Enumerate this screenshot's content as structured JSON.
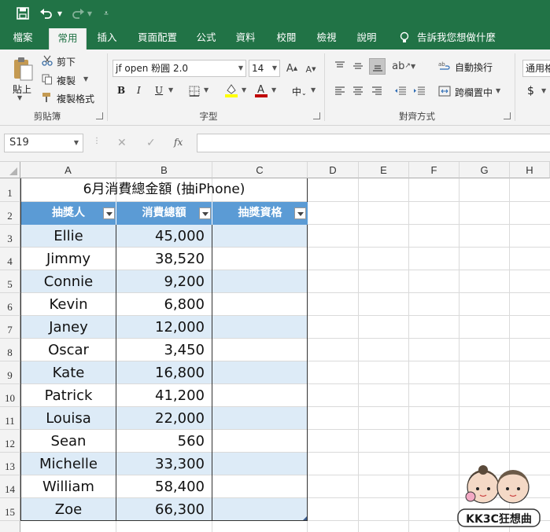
{
  "qat": {
    "save_icon": "save-icon",
    "undo_icon": "undo-icon",
    "redo_icon": "redo-icon",
    "customize_icon": "customize-qat-icon"
  },
  "tabs": [
    {
      "label": "檔案"
    },
    {
      "label": "常用"
    },
    {
      "label": "插入"
    },
    {
      "label": "頁面配置"
    },
    {
      "label": "公式"
    },
    {
      "label": "資料"
    },
    {
      "label": "校閱"
    },
    {
      "label": "檢視"
    },
    {
      "label": "說明"
    },
    {
      "label": "告訴我您想做什麼"
    }
  ],
  "active_tab": "常用",
  "clipboard": {
    "paste": "貼上",
    "cut": "剪下",
    "copy": "複製",
    "format_painter": "複製格式",
    "group": "剪貼簿"
  },
  "font": {
    "name": "jf open 粉圓 2.0",
    "size": "14",
    "bold": "B",
    "italic": "I",
    "underline": "U",
    "group": "字型",
    "font_color": "#c00000",
    "highlight_color": "#ffff00"
  },
  "alignment": {
    "wrap_text": "自動換行",
    "merge_center": "跨欄置中",
    "group": "對齊方式"
  },
  "number": {
    "format": "通用格",
    "currency": "$"
  },
  "formula_bar": {
    "name_box": "S19",
    "cancel": "✕",
    "enter": "✓",
    "fx": "fx",
    "value": ""
  },
  "columns": [
    "A",
    "B",
    "C",
    "D",
    "E",
    "F",
    "G",
    "H"
  ],
  "rows": [
    "1",
    "2",
    "3",
    "4",
    "5",
    "6",
    "7",
    "8",
    "9",
    "10",
    "11",
    "12",
    "13",
    "14",
    "15"
  ],
  "sheet": {
    "title": "6月消費總金額 (抽iPhone)",
    "headers": [
      "抽獎人",
      "消費總額",
      "抽獎資格"
    ],
    "data": [
      {
        "name": "Ellie",
        "amount": "45,000",
        "eligible": ""
      },
      {
        "name": "Jimmy",
        "amount": "38,520",
        "eligible": ""
      },
      {
        "name": "Connie",
        "amount": "9,200",
        "eligible": ""
      },
      {
        "name": "Kevin",
        "amount": "6,800",
        "eligible": ""
      },
      {
        "name": "Janey",
        "amount": "12,000",
        "eligible": ""
      },
      {
        "name": "Oscar",
        "amount": "3,450",
        "eligible": ""
      },
      {
        "name": "Kate",
        "amount": "16,800",
        "eligible": ""
      },
      {
        "name": "Patrick",
        "amount": "41,200",
        "eligible": ""
      },
      {
        "name": "Louisa",
        "amount": "22,000",
        "eligible": ""
      },
      {
        "name": "Sean",
        "amount": "560",
        "eligible": ""
      },
      {
        "name": "Michelle",
        "amount": "33,300",
        "eligible": ""
      },
      {
        "name": "William",
        "amount": "58,400",
        "eligible": ""
      },
      {
        "name": "Zoe",
        "amount": "66,300",
        "eligible": ""
      }
    ]
  },
  "colors": {
    "excel_green": "#217346",
    "table_header": "#5b9bd5",
    "table_band": "#ddebf7"
  },
  "watermark": {
    "text": "KK3C狂想曲"
  }
}
